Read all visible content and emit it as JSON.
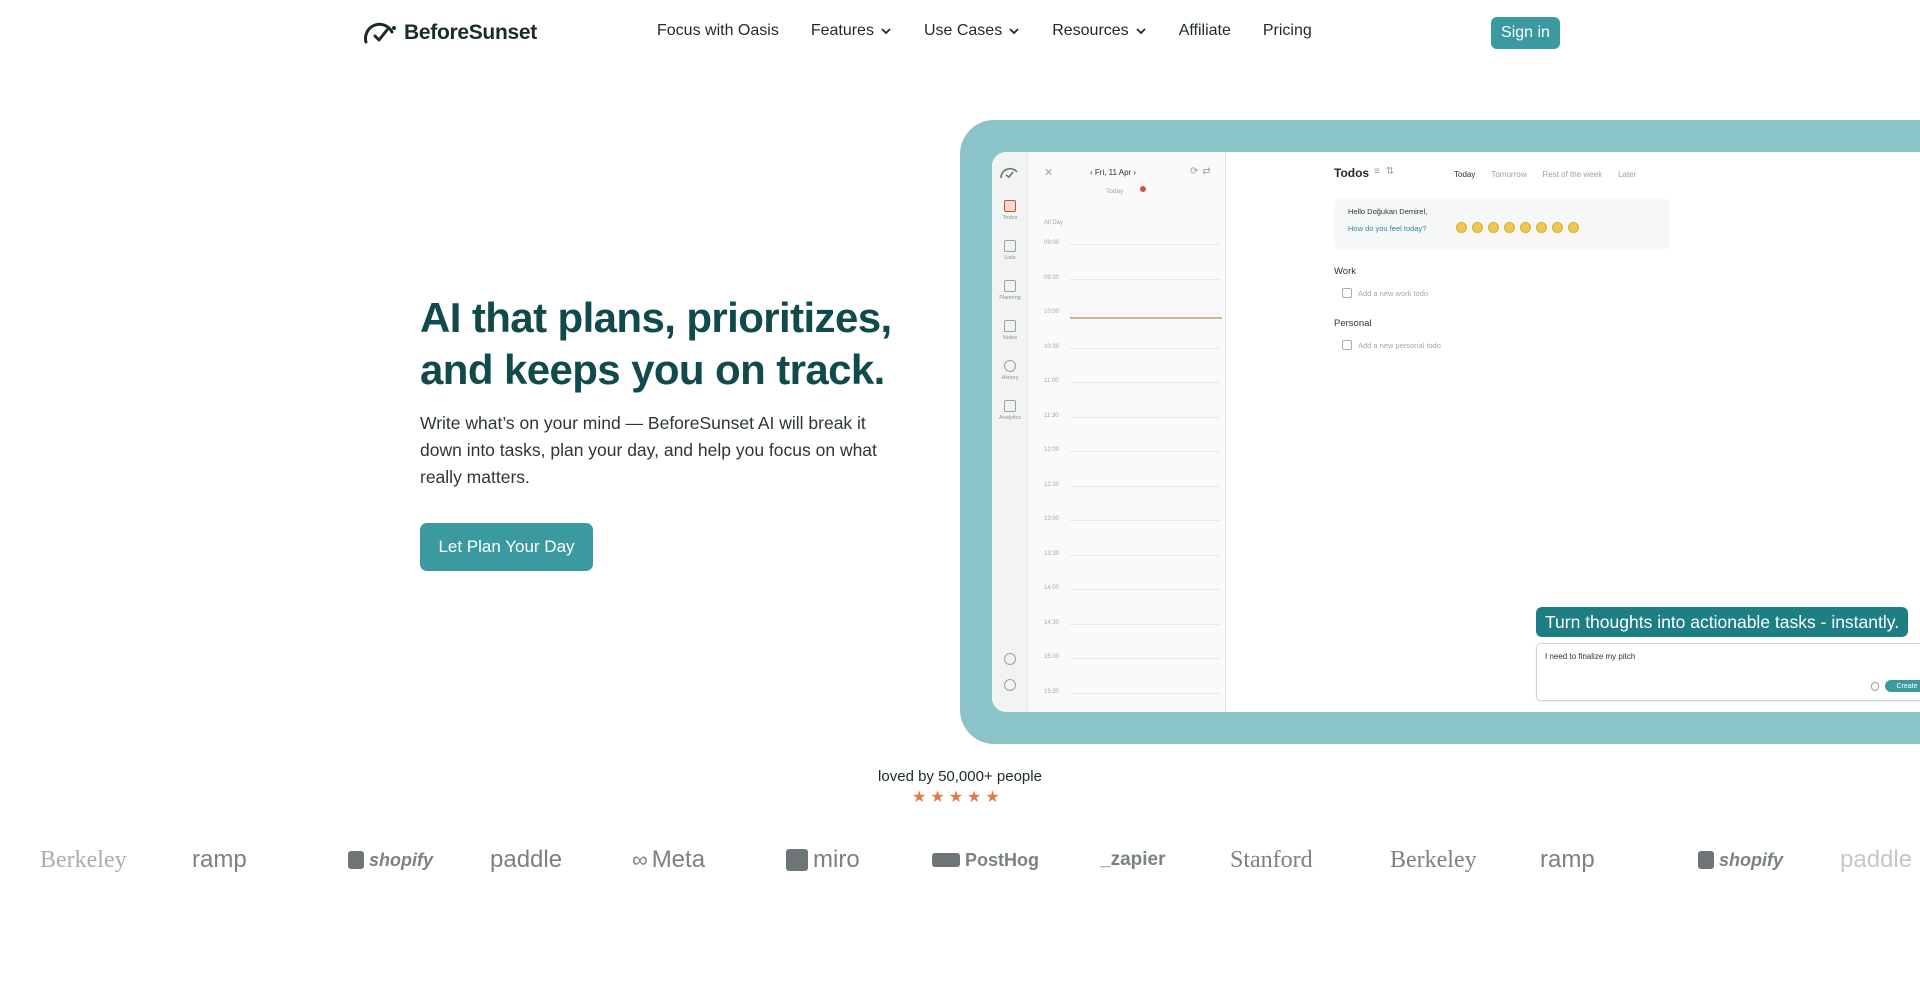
{
  "brand": {
    "name": "BeforeSunset"
  },
  "nav": {
    "links": [
      {
        "label": "Focus with Oasis",
        "has_dropdown": false
      },
      {
        "label": "Features",
        "has_dropdown": true
      },
      {
        "label": "Use Cases",
        "has_dropdown": true
      },
      {
        "label": "Resources",
        "has_dropdown": true
      },
      {
        "label": "Affiliate",
        "has_dropdown": false
      },
      {
        "label": "Pricing",
        "has_dropdown": false
      }
    ],
    "signin_label": "Sign in"
  },
  "hero": {
    "title": "AI that plans, prioritizes, and keeps you on track.",
    "subtitle": "Write what’s on your mind — BeforeSunset AI will break it down into tasks, plan your day, and help you focus on what really matters.",
    "cta_label": "Let Plan Your Day"
  },
  "app": {
    "sidebar": [
      {
        "label": "Todos",
        "icon": "todos-icon",
        "active": true
      },
      {
        "label": "Lists",
        "icon": "lists-icon",
        "active": false
      },
      {
        "label": "Planning",
        "icon": "calendar-icon",
        "active": false
      },
      {
        "label": "Notes",
        "icon": "notes-icon",
        "active": false
      },
      {
        "label": "History",
        "icon": "history-icon",
        "active": false
      },
      {
        "label": "Analytics",
        "icon": "analytics-icon",
        "active": false
      }
    ],
    "calendar": {
      "date": "Fri, 11 Apr",
      "today": "Today",
      "all_day": "All Day",
      "times": [
        "09:00",
        "09:30",
        "10:00",
        "10:30",
        "11:00",
        "11:30",
        "12:00",
        "12:30",
        "13:00",
        "13:30",
        "14:00",
        "14:30",
        "15:00",
        "15:30"
      ]
    },
    "todos": {
      "title": "Todos",
      "tabs": [
        "Today",
        "Tomorrow",
        "Rest of the week",
        "Later"
      ],
      "active_tab": "Today",
      "greeting": "Hello Doğukan Demirel,",
      "mood_question": "How do you feel today?",
      "groups": [
        {
          "name": "Work",
          "placeholder": "Add a new work todo"
        },
        {
          "name": "Personal",
          "placeholder": "Add a new personal todo"
        }
      ]
    },
    "tagline": "Turn thoughts into actionable tasks - instantly.",
    "input_text": "I need to finalize my pitch",
    "create_label": "Create"
  },
  "social": {
    "loved": "loved by 50,000+ people",
    "stars": 5,
    "logos": [
      "Berkeley",
      "ramp",
      "shopify",
      "paddle",
      "Meta",
      "miro",
      "PostHog",
      "_zapier",
      "Stanford",
      "Berkeley",
      "ramp",
      "shopify",
      "paddle"
    ]
  },
  "colors": {
    "accent": "#3a9aa0",
    "heading": "#114a4b",
    "frame": "#8ac4c8",
    "star": "#e07a4b"
  }
}
